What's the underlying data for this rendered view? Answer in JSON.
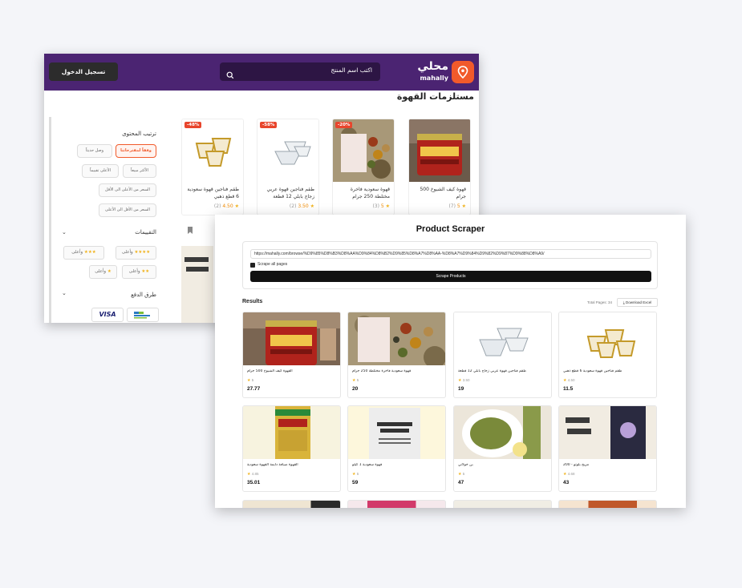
{
  "site": {
    "logo_ar": "محلي",
    "logo_en": "mahally",
    "search_placeholder": "اكتب اسم المنتج",
    "login_label": "تسجيل الدخول",
    "page_title": "مستلزمات القهوة",
    "products": [
      {
        "name": "قهوة كيف الشيوخ 500 جرام",
        "rating": "5",
        "count": "(7)",
        "discount": ""
      },
      {
        "name": "قهوة سعودية فاخرة مختلطة 250 جرام",
        "rating": "5",
        "count": "(3)",
        "discount": "-20%"
      },
      {
        "name": "طقم فناجين قهوة عربي زجاج بابلي 12 قطعة",
        "rating": "3.50",
        "count": "(2)",
        "discount": "-58%"
      },
      {
        "name": "طقم فناجين قهوة سعودية 6 قطع ذهبي",
        "rating": "4.50",
        "count": "(2)",
        "discount": "-48%"
      }
    ],
    "filters": {
      "sort_title": "ترتيب المحتوى",
      "sort_options": [
        "وفقاً لمقترحاتنا",
        "وصل حديثاً",
        "الأكثر مبيعاً",
        "الأعلى تقييماً",
        "السعر من الأعلى الى الأقل",
        "السعر من الأقل الى الأعلى"
      ],
      "ratings_title": "التقييمات",
      "rating_suffix": "وأعلى",
      "payment_title": "طرق الدفع",
      "visa_label": "VISA",
      "thiqah_label": "THIQAH"
    }
  },
  "scraper": {
    "title": "Product Scraper",
    "url_value": "https://mahally.com/browse/%D9%85%D8%B3%D8%AA%D9%84%D8%B2%D9%85%D8%A7%D8%AA-%D8%A7%D9%84%D9%82%D9%87%D9%88%D8%A9/",
    "scrape_all_label": "Scrape all pages",
    "scrape_all_checked": true,
    "scrape_button": "Scrape Products",
    "results_label": "Results",
    "total_pages": "Total Pages: 34",
    "download_label": "Download Excel",
    "results": [
      {
        "name": "القهوة كيف الشيوخ 500 جرام",
        "rating": "5",
        "price": "27.77"
      },
      {
        "name": "قهوة سعودية فاخرة مختلطة 250 جرام",
        "rating": "5",
        "price": "20"
      },
      {
        "name": "طقم فناجين قهوة عربي زجاج بابلي 12 قطعة",
        "rating": "3.50",
        "price": "19"
      },
      {
        "name": "طقم فناجين قهوة سعودية 6 قطع ذهبي",
        "rating": "4.50",
        "price": "11.5"
      },
      {
        "name": "القهوة ضيافة دايمة القهوة سعودية",
        "rating": "4.85",
        "price": "35.01"
      },
      {
        "name": "قهوة سعودية 1 كيلو",
        "rating": "5",
        "price": "59"
      },
      {
        "name": "بن خولاني",
        "rating": "5",
        "price": "47"
      },
      {
        "name": "مزيج بلوتو - 200",
        "rating": "4.68",
        "price": "43"
      }
    ]
  }
}
